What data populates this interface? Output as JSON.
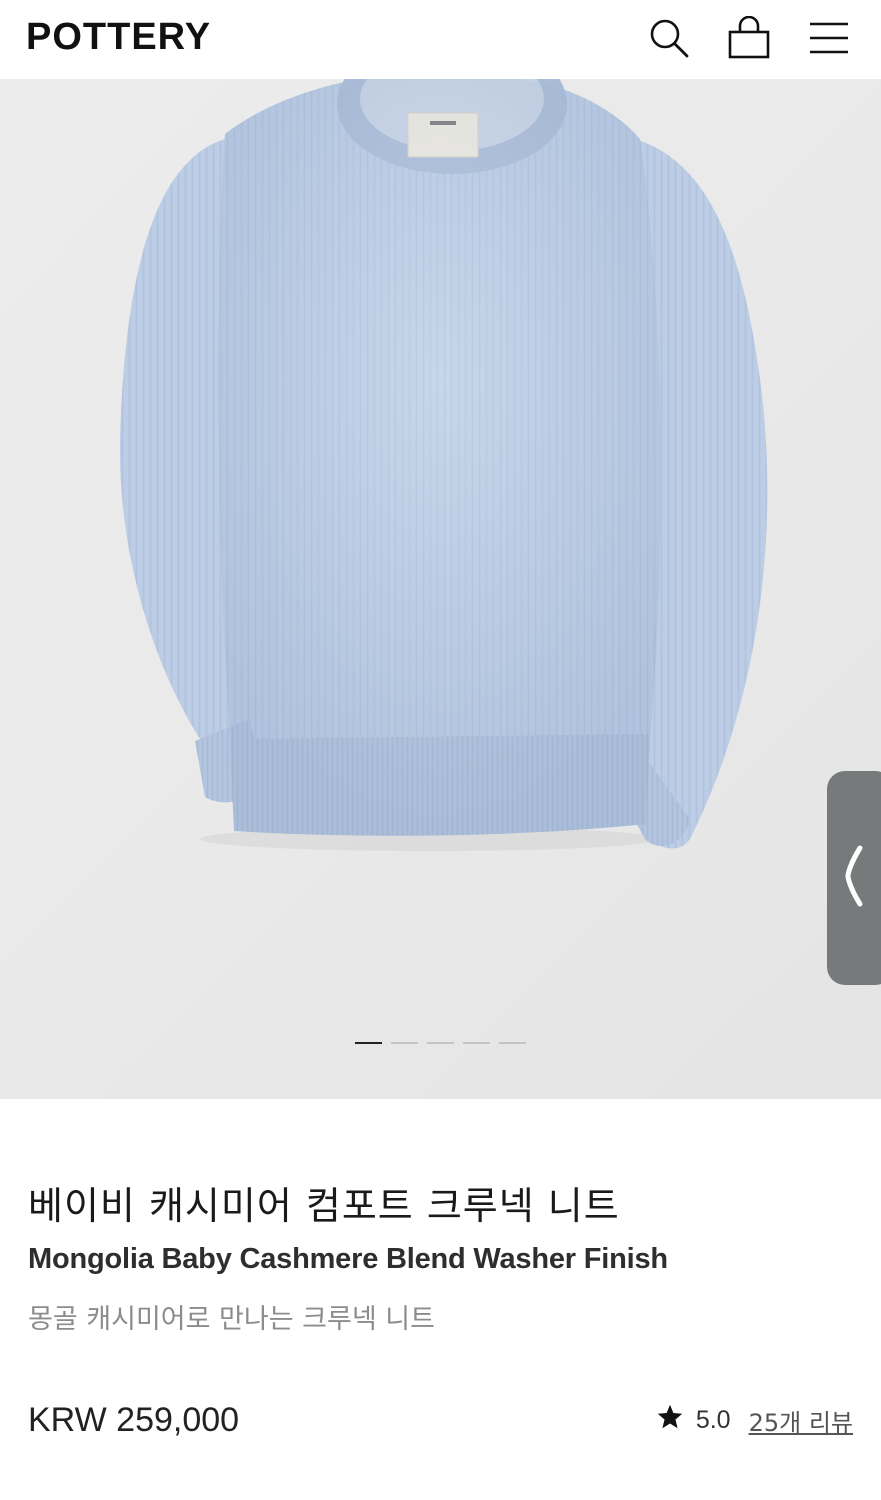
{
  "header": {
    "logo": "POTTERY",
    "icons": [
      "search-icon",
      "shopping-bag-icon",
      "menu-icon"
    ]
  },
  "gallery": {
    "image_subject": "light blue knit crewneck sweater",
    "slide_count": 5,
    "active_slide": 1,
    "side_tab_glyph": "❬"
  },
  "product": {
    "title_ko": "베이비 캐시미어 컴포트 크루넥 니트",
    "title_en": "Mongolia Baby Cashmere Blend Washer Finish",
    "subtitle": "몽골 캐시미어로 만나는 크루넥 니트",
    "price": "KRW 259,000",
    "rating": "5.0",
    "reviews": "25개 리뷰"
  },
  "colors": {
    "sweater": "#b9cbe4",
    "side_tab": "#777a7a",
    "active_dot": "#222222",
    "inactive_dot": "#c4c4c4"
  }
}
